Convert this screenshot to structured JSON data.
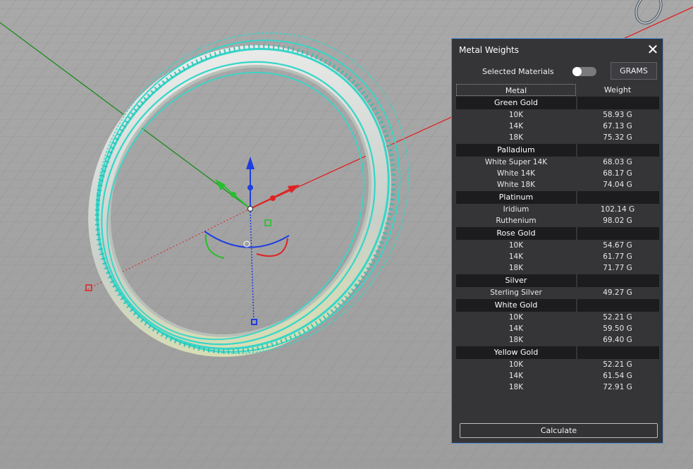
{
  "panel": {
    "title": "Metal Weights",
    "close_glyph": "✕",
    "selected_materials_label": "Selected Materials",
    "selected_materials_on": false,
    "units_button": "GRAMS",
    "col_metal": "Metal",
    "col_weight": "Weight",
    "groups": [
      {
        "name": "Green Gold",
        "rows": [
          {
            "metal": "10K",
            "weight": "58.93 G"
          },
          {
            "metal": "14K",
            "weight": "67.13 G"
          },
          {
            "metal": "18K",
            "weight": "75.32 G"
          }
        ]
      },
      {
        "name": "Palladium",
        "rows": [
          {
            "metal": "White Super 14K",
            "weight": "68.03 G"
          },
          {
            "metal": "White 14K",
            "weight": "68.17 G"
          },
          {
            "metal": "White 18K",
            "weight": "74.04 G"
          }
        ]
      },
      {
        "name": "Platinum",
        "rows": [
          {
            "metal": "Iridium",
            "weight": "102.14 G"
          },
          {
            "metal": "Ruthenium",
            "weight": "98.02 G"
          }
        ]
      },
      {
        "name": "Rose Gold",
        "rows": [
          {
            "metal": "10K",
            "weight": "54.67 G"
          },
          {
            "metal": "14K",
            "weight": "61.77 G"
          },
          {
            "metal": "18K",
            "weight": "71.77 G"
          }
        ]
      },
      {
        "name": "Silver",
        "rows": [
          {
            "metal": "Sterling Silver",
            "weight": "49.27 G"
          }
        ]
      },
      {
        "name": "White Gold",
        "rows": [
          {
            "metal": "10K",
            "weight": "52.21 G"
          },
          {
            "metal": "14K",
            "weight": "59.50 G"
          },
          {
            "metal": "18K",
            "weight": "69.40 G"
          }
        ]
      },
      {
        "name": "Yellow Gold",
        "rows": [
          {
            "metal": "10K",
            "weight": "52.21 G"
          },
          {
            "metal": "14K",
            "weight": "61.54 G"
          },
          {
            "metal": "18K",
            "weight": "72.91 G"
          }
        ]
      }
    ],
    "calculate_button": "Calculate"
  },
  "viewport": {
    "grid_color": "#8e8e8e",
    "background_color": "#a3a3a3",
    "x_axis_color": "#e02020",
    "y_axis_color": "#1a8a1a",
    "wireframe_color": "#35d6c8",
    "ring_color": "#d8dcd8",
    "gizmo_blue": "#1f3ee0",
    "gizmo_red": "#e02222",
    "gizmo_green": "#22c02a",
    "icons": [
      "move-gizmo-icon",
      "rotate-gizmo-icon",
      "scale-handle-icon",
      "ring-thumbnail-icon"
    ]
  }
}
